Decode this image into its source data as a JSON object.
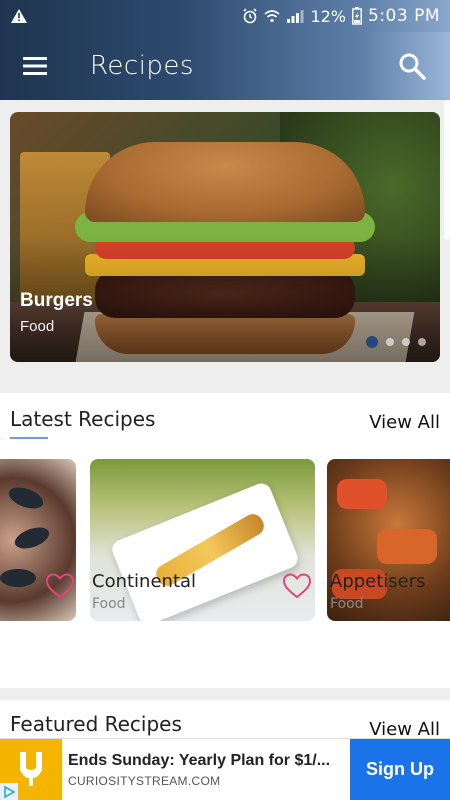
{
  "status": {
    "battery": "12%",
    "time": "5:03 PM"
  },
  "appbar": {
    "title": "Recipes"
  },
  "hero": {
    "title": "Burgers",
    "subtitle": "Food",
    "slides": 4,
    "active_slide": 1
  },
  "latest": {
    "title": "Latest Recipes",
    "view_all": "View All",
    "cards": [
      {
        "name": "Continental",
        "category": "Food"
      },
      {
        "name": "Appetisers",
        "category": "Food"
      }
    ]
  },
  "featured": {
    "title": "Featured Recipes",
    "view_all": "View All"
  },
  "ad": {
    "headline": "Ends Sunday: Yearly Plan for $1/...",
    "url": "CURIOSITYSTREAM.COM",
    "button": "Sign Up"
  },
  "colors": {
    "primary": "#26477a",
    "accent_heart": "#e0457b",
    "ad_button": "#1a73e8",
    "ad_logo": "#f5b400"
  }
}
